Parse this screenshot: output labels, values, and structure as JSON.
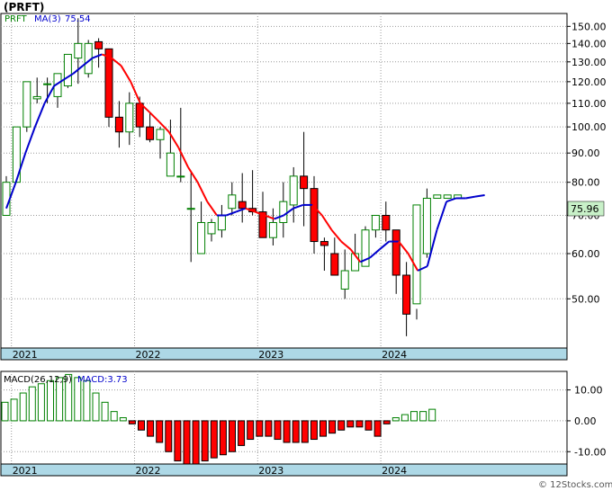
{
  "title": "(PRFT)",
  "watermark": "© 12Stocks.com",
  "price_panel": {
    "legend_ticker": "PRFT",
    "legend_ma_label": "MA(3)",
    "legend_ma_value": "75.54",
    "last_price_label": "75.96",
    "y_ticks": [
      "150.00",
      "140.00",
      "130.00",
      "120.00",
      "110.00",
      "100.00",
      "90.00",
      "80.00",
      "70.00",
      "60.00",
      "50.00"
    ],
    "x_labels": [
      "2021",
      "2022",
      "2023",
      "2024"
    ],
    "colors": {
      "up": "#008000",
      "down": "#ff0000",
      "ma_rising": "#0000cc",
      "ma_falling": "#ff0000",
      "axis_band": "#add8e6",
      "last_price_bg": "#c8f0c8"
    }
  },
  "macd_panel": {
    "legend_label": "MACD(26,12,9)",
    "legend_value": "MACD:3.73",
    "y_ticks": [
      "10.00",
      "0.00",
      "-10.00"
    ],
    "x_labels": [
      "2021",
      "2022",
      "2023",
      "2024"
    ]
  },
  "chart_data": [
    {
      "type": "candlestick",
      "name": "PRFT monthly price",
      "scale": "log",
      "ylim": [
        41,
        158
      ],
      "x": [
        "2020-12",
        "2021-01",
        "2021-02",
        "2021-03",
        "2021-04",
        "2021-05",
        "2021-06",
        "2021-07",
        "2021-08",
        "2021-09",
        "2021-10",
        "2021-11",
        "2021-12",
        "2022-01",
        "2022-02",
        "2022-03",
        "2022-04",
        "2022-05",
        "2022-06",
        "2022-07",
        "2022-08",
        "2022-09",
        "2022-10",
        "2022-11",
        "2022-12",
        "2023-01",
        "2023-02",
        "2023-03",
        "2023-04",
        "2023-05",
        "2023-06",
        "2023-07",
        "2023-08",
        "2023-09",
        "2023-10",
        "2023-11",
        "2023-12",
        "2024-01",
        "2024-02",
        "2024-03",
        "2024-04",
        "2024-05",
        "2024-06",
        "2024-07",
        "2024-08",
        "2024-09",
        "2024-10"
      ],
      "open": [
        70,
        80,
        100,
        112,
        119,
        113,
        118,
        132,
        124,
        141,
        137,
        104,
        98,
        110,
        100,
        95,
        82,
        82,
        72,
        60,
        65,
        66,
        72,
        74,
        72,
        71,
        64,
        68,
        73,
        82,
        78,
        63,
        60,
        52,
        56,
        57,
        66,
        70,
        66,
        55,
        49,
        60,
        75,
        75,
        75
      ],
      "high": [
        82,
        97,
        118,
        122,
        122,
        120,
        132,
        155,
        142,
        143,
        137,
        111,
        115,
        113,
        106,
        100,
        103,
        108,
        83,
        74,
        69,
        73,
        80,
        83,
        84,
        77,
        72,
        80,
        85,
        98,
        82,
        64,
        64,
        61,
        65,
        67,
        70,
        74,
        66,
        58,
        48,
        78,
        76,
        76,
        76
      ],
      "low": [
        70,
        80,
        98,
        110,
        110,
        108,
        117,
        119,
        122,
        127,
        100,
        92,
        93,
        96,
        94,
        88,
        85,
        80,
        58,
        62,
        63,
        64,
        70,
        68,
        70,
        65,
        62,
        64,
        68,
        67,
        60,
        56,
        56,
        50,
        56,
        58,
        64,
        63,
        51,
        43,
        46,
        59,
        75,
        75,
        75
      ],
      "close": [
        80,
        100,
        120,
        113,
        119,
        124,
        134,
        140,
        140,
        137,
        104,
        98,
        110,
        100,
        95,
        99,
        90,
        82,
        72,
        68,
        68,
        70,
        76,
        72,
        71,
        64,
        68,
        74,
        82,
        78,
        63,
        62,
        55,
        56,
        60,
        66,
        70,
        66,
        55,
        47,
        73,
        75,
        76,
        76,
        76
      ],
      "ma_label": "MA(3)",
      "ma": [
        72,
        80,
        90,
        100,
        110,
        118,
        121,
        124,
        128,
        132,
        134,
        132,
        128,
        120,
        110,
        106,
        102,
        98,
        92,
        85,
        80,
        74,
        70,
        70,
        71,
        72,
        71,
        70,
        69,
        70,
        72,
        73,
        73,
        70,
        66,
        63,
        61,
        58,
        59,
        61,
        63,
        63,
        60,
        56,
        57,
        66,
        74,
        75,
        75,
        75.5,
        75.96
      ]
    },
    {
      "type": "bar",
      "name": "MACD(26,12,9)",
      "ylim": [
        -14,
        16
      ],
      "values": [
        6,
        7,
        9,
        11,
        12,
        13,
        14,
        15,
        14,
        13,
        9,
        6,
        3,
        1,
        -1,
        -3,
        -5,
        -7,
        -10,
        -13,
        -14,
        -14,
        -13,
        -12,
        -11,
        -10,
        -8,
        -6,
        -5,
        -5,
        -6,
        -7,
        -7,
        -7,
        -6,
        -5,
        -4,
        -3,
        -2,
        -2,
        -3,
        -5,
        -1,
        1,
        2,
        3,
        3,
        3.73
      ]
    }
  ]
}
